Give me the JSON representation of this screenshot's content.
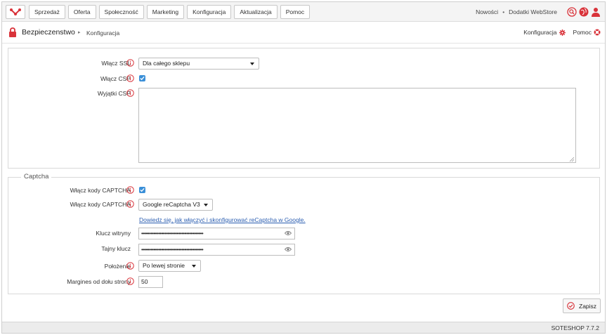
{
  "nav": {
    "items": [
      {
        "label": "Sprzedaż"
      },
      {
        "label": "Oferta"
      },
      {
        "label": "Społeczność"
      },
      {
        "label": "Marketing"
      },
      {
        "label": "Konfiguracja"
      },
      {
        "label": "Aktualizacja"
      },
      {
        "label": "Pomoc"
      }
    ],
    "news_label": "Nowości",
    "separator": "•",
    "webstore_label": "Dodatki WebStore"
  },
  "breadcrumb": {
    "title": "Bezpieczenstwo",
    "separator": "▸",
    "current": "Konfiguracja",
    "right_config_label": "Konfiguracja",
    "right_help_label": "Pomoc"
  },
  "security": {
    "ssl_label": "Włącz SSL",
    "ssl_value": "Dla całego sklepu",
    "csp_label": "Włącz CSP",
    "csp_checked": true,
    "csp_exceptions_label": "Wyjątki CSP",
    "csp_exceptions_value": ""
  },
  "captcha": {
    "legend": "Captcha",
    "enable_label": "Włącz kody CAPTCHA",
    "enable_checked": true,
    "type_label": "Włącz kody CAPTCHA",
    "type_value": "Google reCaptcha V3",
    "help_link": "Dowiedz się, jak włączyć i skonfigurować reCaptcha w Google.",
    "site_key_label": "Klucz witryny",
    "site_key_value": "••••••••••••••••••••••••••••••••••••••••",
    "secret_key_label": "Tajny klucz",
    "secret_key_value": "••••••••••••••••••••••••••••••••••••••••",
    "position_label": "Położenie",
    "position_value": "Po lewej stronie",
    "margin_label": "Margines od dołu strony",
    "margin_value": "50"
  },
  "actions": {
    "save_label": "Zapisz"
  },
  "footer": {
    "version": "SOTESHOP 7.7.2"
  },
  "colors": {
    "accent_red": "#d9333a",
    "checkbox_blue": "#3a8fd8",
    "link_blue": "#2a5db0"
  }
}
